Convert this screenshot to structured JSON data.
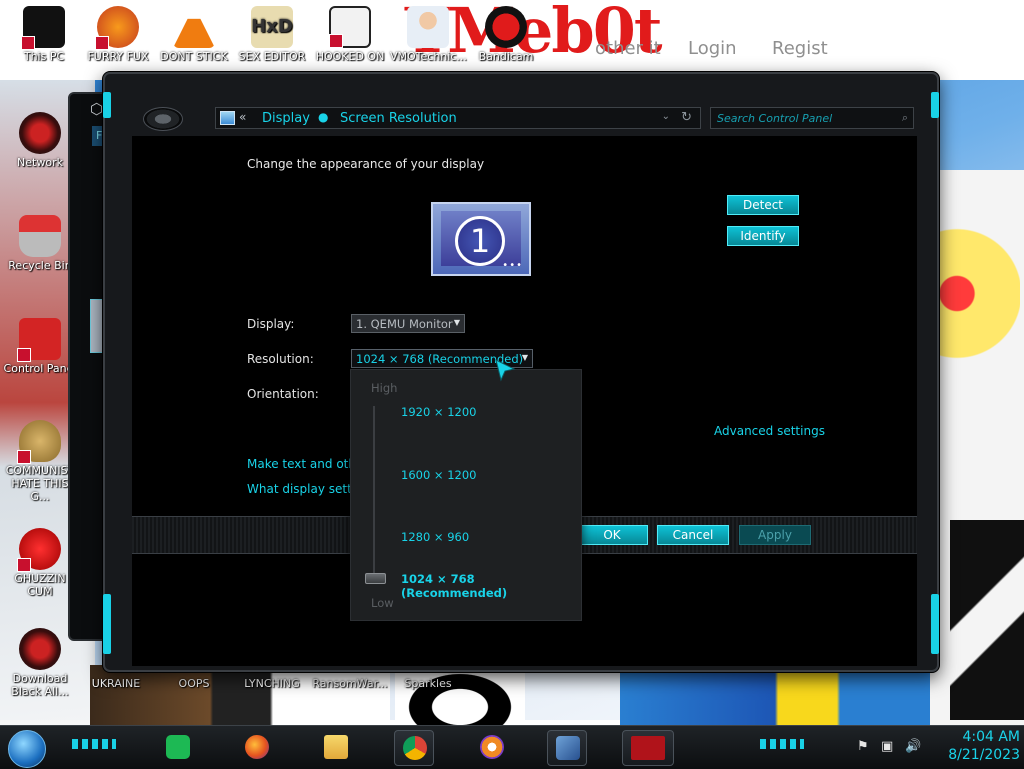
{
  "desktop": {
    "watermark": "YMeb0t",
    "ghost_links": [
      "other it",
      "Login",
      "Regist"
    ],
    "top_icons": [
      {
        "label": "This PC",
        "color": "#8b1a1a"
      },
      {
        "label": "FURRY FUX",
        "color": "#e66d1a"
      },
      {
        "label": "DONT STICK",
        "color": "#f07c10"
      },
      {
        "label": "SEX EDITOR",
        "color": "#d8c07a"
      },
      {
        "label": "HOOKED ON",
        "color": "#444444"
      },
      {
        "label": "VMOTechnic...",
        "color": "#d7e4f2"
      },
      {
        "label": "Bandicam",
        "color": "#111111"
      }
    ],
    "left_icons": [
      {
        "label": "Network",
        "color": "#6b1b1b"
      },
      {
        "label": "Recycle Bin",
        "color": "#b92e2e"
      },
      {
        "label": "Control Panel",
        "color": "#d32424"
      },
      {
        "label": "COMMUNIST HATE THIS G...",
        "color": "#c5a35a"
      },
      {
        "label": "GHUZZIN CUM",
        "color": "#c31414"
      },
      {
        "label": "Download Black All...",
        "color": "#6b1b1b"
      }
    ],
    "bottom_labels": [
      "UKRAINE",
      "OOPS",
      "LYNCHING",
      "RansomWar...",
      "Sparkles"
    ]
  },
  "window": {
    "breadcrumb": [
      "Display",
      "Screen Resolution"
    ],
    "search_placeholder": "Search Control Panel",
    "back_window_letter": "Fi",
    "heading": "Change the appearance of your display",
    "monitor_number": "1",
    "monitor_dots": "•••",
    "buttons": {
      "detect": "Detect",
      "identify": "Identify",
      "ok": "OK",
      "cancel": "Cancel",
      "apply": "Apply"
    },
    "labels": {
      "display": "Display:",
      "resolution": "Resolution:",
      "orientation": "Orientation:"
    },
    "display_value": "1. QEMU Monitor",
    "resolution_value": "1024 × 768 (Recommended)",
    "links": {
      "advanced": "Advanced settings",
      "make_text": "Make text and other",
      "what_display": "What display setting"
    }
  },
  "resolution_dropdown": {
    "high_label": "High",
    "low_label": "Low",
    "options": [
      {
        "label": "1920 × 1200",
        "selected": false
      },
      {
        "label": "1600 × 1200",
        "selected": false
      },
      {
        "label": "1280 × 960",
        "selected": false
      },
      {
        "label": "1024 × 768 (Recommended)",
        "selected": true
      }
    ]
  },
  "taskbar": {
    "apps": [
      "spotify-icon",
      "firefox-icon",
      "file-explorer-icon",
      "chrome-icon",
      "proton-vpn-icon",
      "virtualbox-icon",
      "active-window-icon"
    ],
    "time": "4:04 AM",
    "date": "8/21/2023"
  },
  "colors": {
    "accent": "#19d3e8",
    "window_bg": "#000000",
    "frame": "#17191c"
  }
}
